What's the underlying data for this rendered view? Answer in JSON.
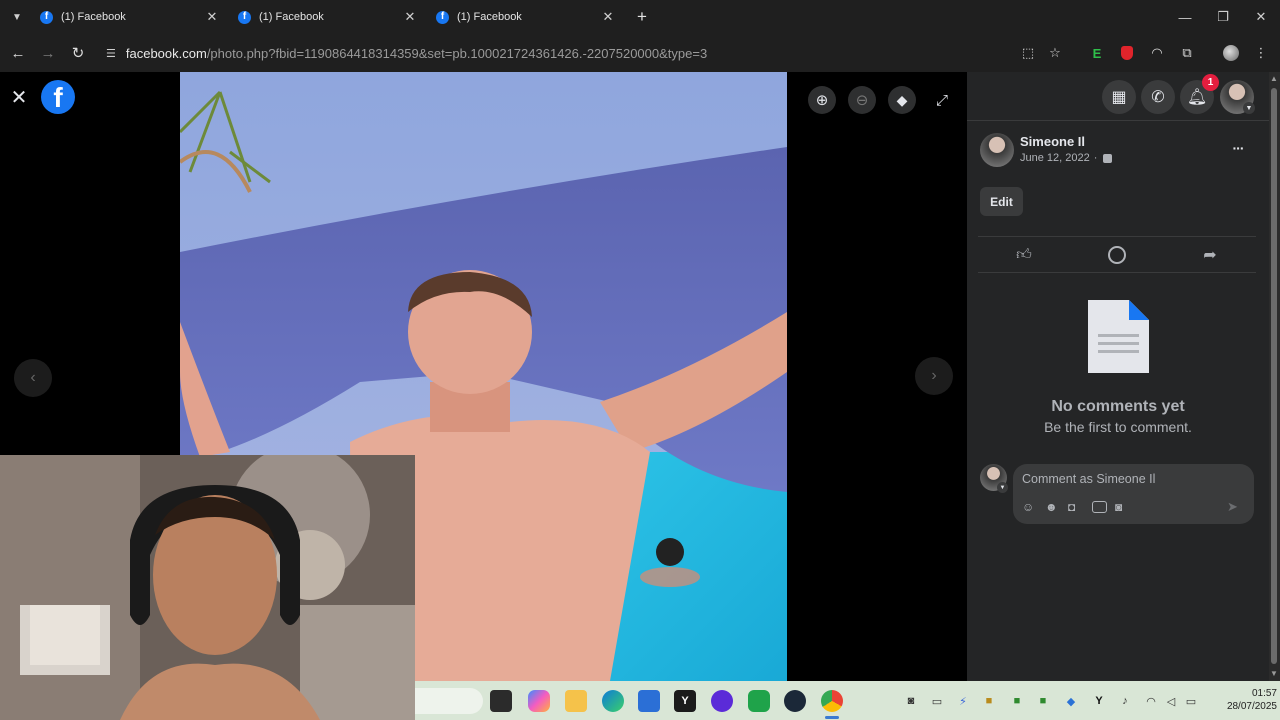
{
  "browser": {
    "tabs": [
      {
        "label": "(1) Facebook",
        "favicon": "f"
      },
      {
        "label": "(1) Facebook",
        "favicon": "f"
      },
      {
        "label": "(1) Facebook",
        "favicon": "f"
      }
    ],
    "url_host": "facebook.com",
    "url_path": "/photo.php?fbid=1190864418314359&set=pb.100021724361426.-2207520000&type=3",
    "extension_letter": "E"
  },
  "viewer": {
    "logo_letter": "f"
  },
  "topnav": {
    "notification_count": "1"
  },
  "post": {
    "author": "Simeone Il",
    "date": "June 12, 2022",
    "date_separator": "·",
    "edit_label": "Edit",
    "more_label": "···"
  },
  "comments": {
    "empty_title": "No comments yet",
    "empty_subtitle": "Be the first to comment.",
    "placeholder": "Comment as Simeone Il"
  },
  "taskbar": {
    "time": "01:57",
    "date": "28/07/2025"
  },
  "colors": {
    "facebook_blue": "#1877f2",
    "panel_bg": "#242526",
    "notification_red": "#e41e3f"
  }
}
